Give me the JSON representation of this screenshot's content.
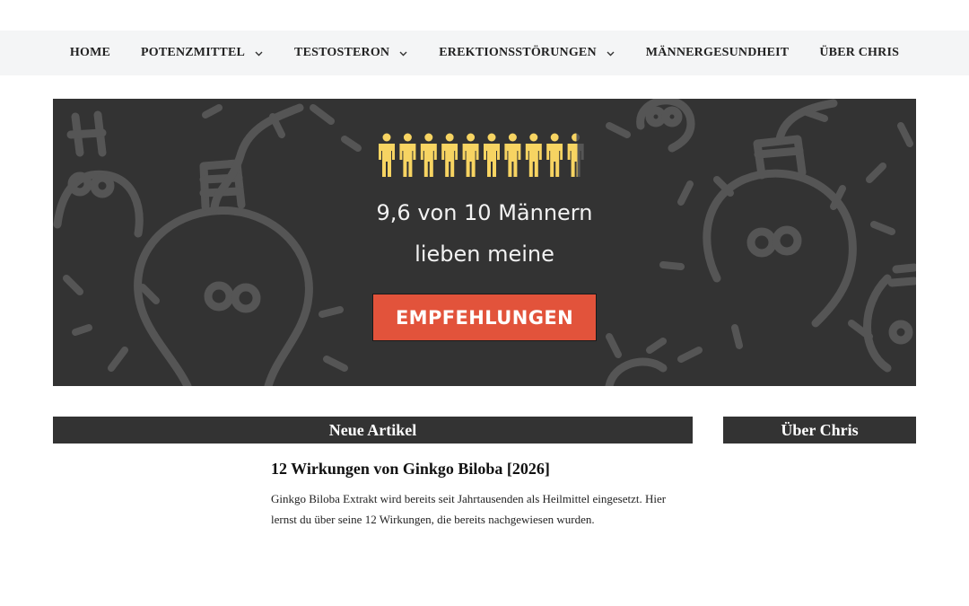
{
  "nav": {
    "items": [
      {
        "label": "HOME",
        "has_dropdown": false
      },
      {
        "label": "POTENZMITTEL",
        "has_dropdown": true
      },
      {
        "label": "TESTOSTERON",
        "has_dropdown": true
      },
      {
        "label": "EREKTIONSSTÖRUNGEN",
        "has_dropdown": true
      },
      {
        "label": "MÄNNERGESUNDHEIT",
        "has_dropdown": false
      },
      {
        "label": "ÜBER CHRIS",
        "has_dropdown": false
      }
    ],
    "dropdown_icon": "chevron-down-icon"
  },
  "banner": {
    "people_icon": "person-icon",
    "people_count": 10,
    "people_filled": 9.6,
    "headline_line1": "9,6 von 10 Männern",
    "headline_line2": "lieben meine",
    "cta_label": "EMPFEHLUNGEN",
    "background_icon": "lightbulb-icon",
    "colors": {
      "background": "#333333",
      "person": "#f7d462",
      "cta": "#e2533b"
    }
  },
  "main": {
    "section_title": "Neue Artikel",
    "articles": [
      {
        "title": "12 Wirkungen von Ginkgo Biloba [2026]",
        "excerpt": "Ginkgo Biloba Extrakt wird bereits seit Jahrtausenden als Heilmittel eingesetzt. Hier lernst du über seine 12 Wirkungen, die bereits nachgewiesen wurden."
      }
    ]
  },
  "sidebar": {
    "section_title": "Über Chris"
  }
}
